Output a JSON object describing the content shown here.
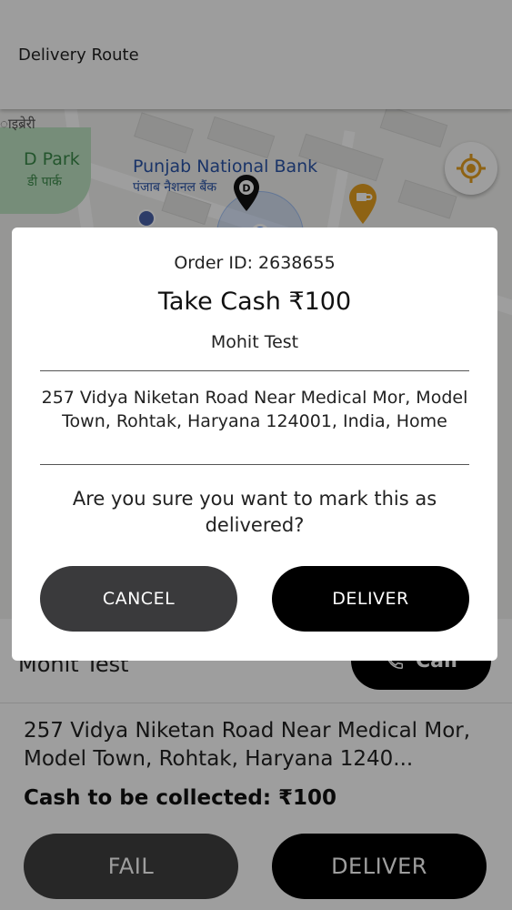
{
  "app_bar": {
    "title": "Delivery Route"
  },
  "map": {
    "labels": {
      "top_left": "ाइब्रेरी",
      "park_en": "D Park",
      "park_hi": "डी पार्क",
      "bank_en": "Punjab National Bank",
      "bank_hi": "पंजाब नैशनल बैंक",
      "pin_letter": "D"
    }
  },
  "panel": {
    "customer_name": "Mohit Test",
    "call_label": "Call",
    "address": "257 Vidya Niketan Road Near Medical Mor, Model Town, Rohtak, Haryana 1240...",
    "cash": "Cash to be collected: ₹100",
    "fail_label": "FAIL",
    "deliver_label": "DELIVER"
  },
  "dialog": {
    "order_id": "Order ID: 2638655",
    "amount": "Take Cash ₹100",
    "customer_name": "Mohit Test",
    "address": "257 Vidya Niketan Road Near Medical Mor, Model Town, Rohtak, Haryana 124001, India, Home",
    "question": "Are you sure you want to mark this as delivered?",
    "cancel_label": "CANCEL",
    "deliver_label": "DELIVER"
  },
  "colors": {
    "overlay": "#00000061",
    "button_dark": "#000000",
    "button_grey": "#3a3a3c",
    "accent_orange": "#e5a021"
  }
}
